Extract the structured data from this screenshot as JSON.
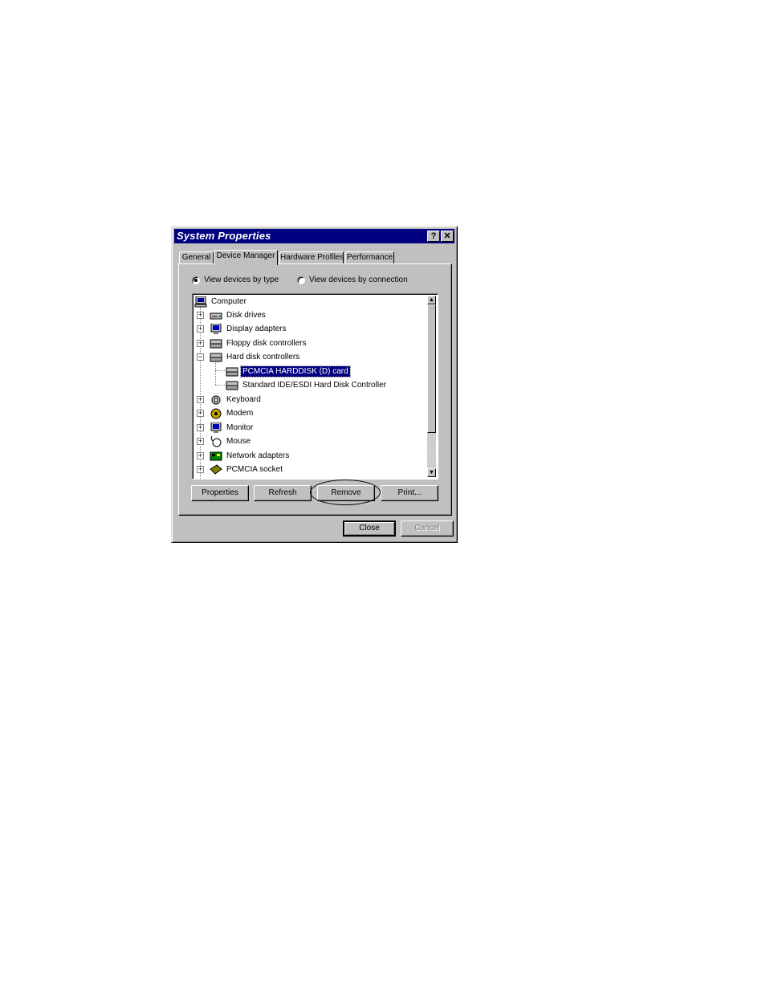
{
  "window": {
    "title": "System Properties",
    "help_button": "?",
    "close_button": "✕"
  },
  "tabs": [
    {
      "label": "General"
    },
    {
      "label": "Device Manager"
    },
    {
      "label": "Hardware Profiles"
    },
    {
      "label": "Performance"
    }
  ],
  "view_options": {
    "by_type": "View devices by type",
    "by_connection": "View devices by connection",
    "selected": "View devices by type"
  },
  "tree": {
    "root": "Computer",
    "items": [
      {
        "label": "Disk drives",
        "expander": "+"
      },
      {
        "label": "Display adapters",
        "expander": "+"
      },
      {
        "label": "Floppy disk controllers",
        "expander": "+"
      },
      {
        "label": "Hard disk controllers",
        "expander": "−"
      },
      {
        "label": "PCMCIA HARDDISK (D) card"
      },
      {
        "label": "Standard IDE/ESDI Hard Disk Controller"
      },
      {
        "label": "Keyboard",
        "expander": "+"
      },
      {
        "label": "Modem",
        "expander": "+"
      },
      {
        "label": "Monitor",
        "expander": "+"
      },
      {
        "label": "Mouse",
        "expander": "+"
      },
      {
        "label": "Network adapters",
        "expander": "+"
      },
      {
        "label": "PCMCIA socket",
        "expander": "+"
      }
    ],
    "selected_item": "PCMCIA HARDDISK (D) card"
  },
  "actions": {
    "properties": "Properties",
    "refresh": "Refresh",
    "remove": "Remove",
    "print": "Print..."
  },
  "footer": {
    "close": "Close",
    "cancel": "Cancel"
  },
  "colors": {
    "titlebar": "#000080",
    "face": "#c0c0c0",
    "selection": "#000080"
  }
}
